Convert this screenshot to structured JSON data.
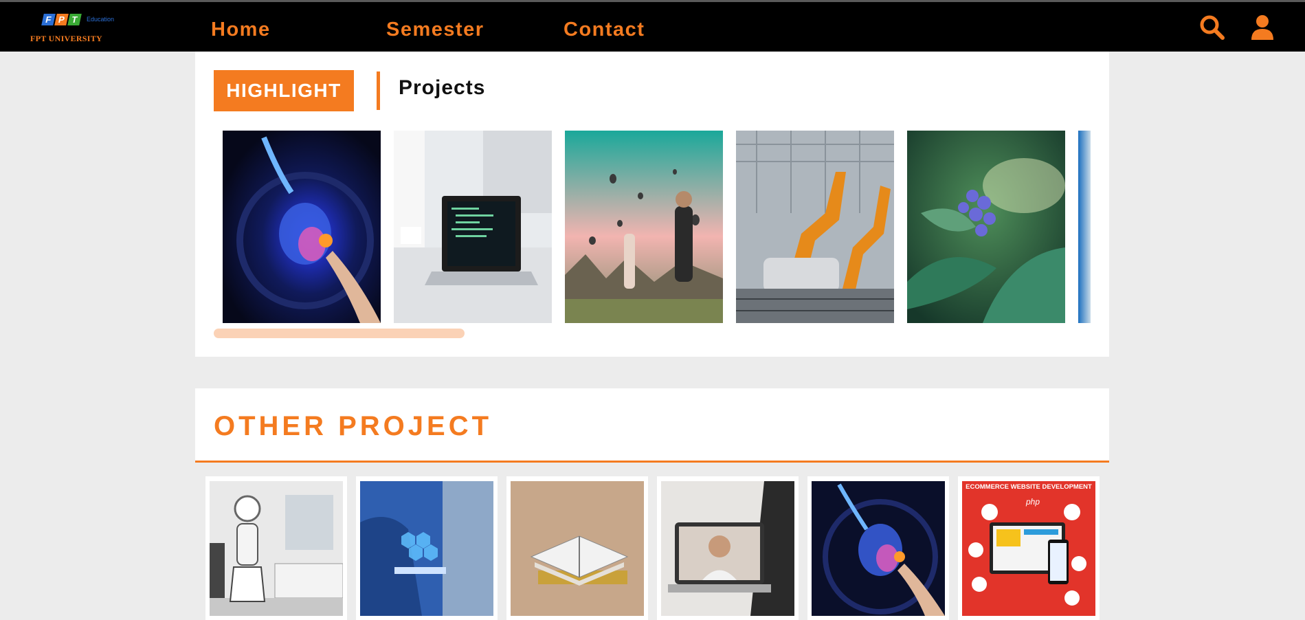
{
  "header": {
    "logo": {
      "letters": [
        "F",
        "P",
        "T"
      ],
      "edu_text": "Education",
      "name": "FPT UNIVERSITY"
    },
    "nav": [
      {
        "label": "Home"
      },
      {
        "label": "Semester"
      },
      {
        "label": "Contact"
      }
    ],
    "icons": [
      "search-icon",
      "user-icon"
    ]
  },
  "highlight": {
    "badge": "HIGHLIGHT",
    "title": "Projects",
    "slides": [
      "ai-brain-hand",
      "laptop-code-desk",
      "hot-air-balloons-travelers",
      "robotic-car-factory",
      "blueberry-plant",
      "partial-blue-image"
    ]
  },
  "other": {
    "title": "OTHER PROJECT",
    "thumbs": [
      {
        "image": "robot-hospital-room"
      },
      {
        "image": "industry-4-0-tablet"
      },
      {
        "image": "open-books"
      },
      {
        "image": "video-call-laptop"
      },
      {
        "image": "ai-brain-hand"
      },
      {
        "image": "ecommerce-banner",
        "text": "ECOMMERCE WEBSITE DEVELOPMENT",
        "icon_labels": [
          "php"
        ]
      }
    ]
  },
  "colors": {
    "accent": "#f47b20",
    "nav_bg": "#000000",
    "page_bg": "#ececec"
  }
}
